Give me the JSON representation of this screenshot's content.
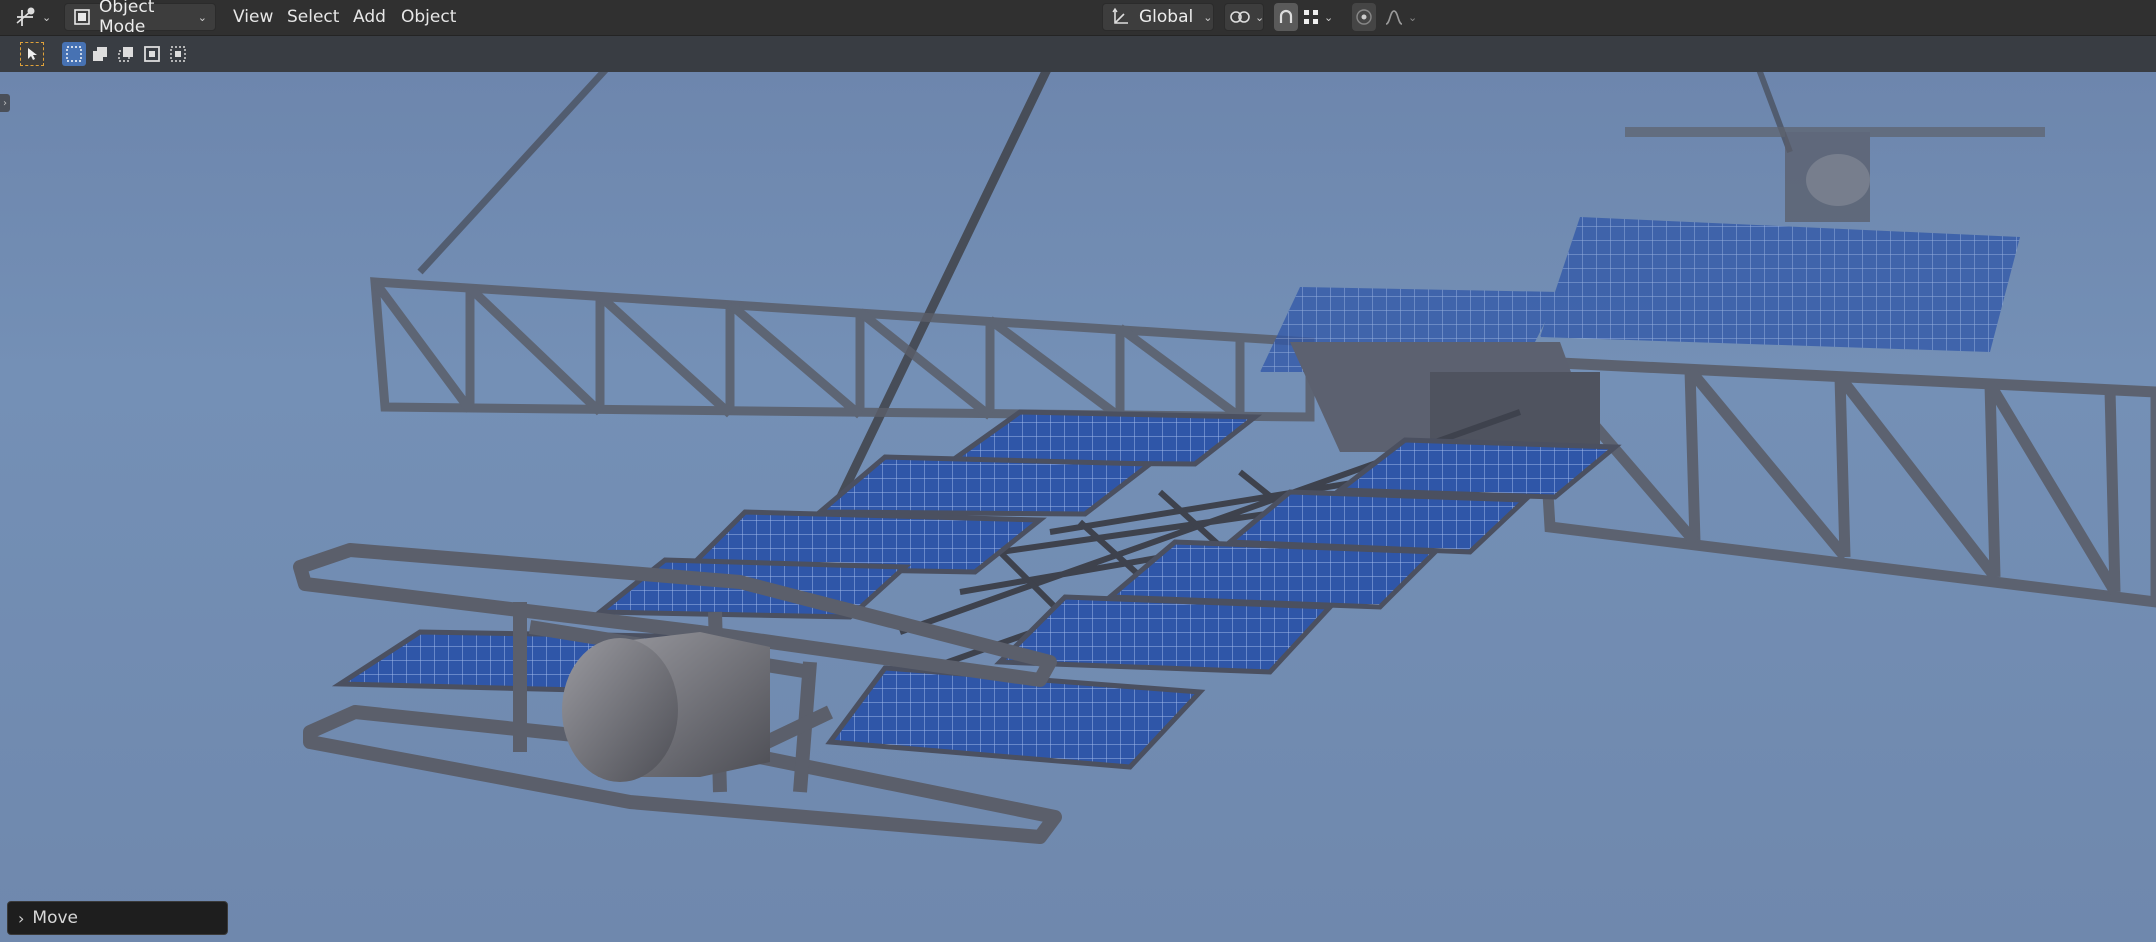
{
  "header": {
    "mode_label": "Object Mode",
    "menus": [
      "View",
      "Select",
      "Add",
      "Object"
    ],
    "orientation_label": "Global"
  },
  "icons": {
    "editor_type": "view3d-gizmo-icon",
    "mode": "object-mode-icon",
    "orientation": "transform-orientation-icon",
    "pivot": "pivot-point-icon",
    "snap": "snap-magnet-icon",
    "snap_target": "snap-increment-icon",
    "proportional": "proportional-editing-icon",
    "falloff": "falloff-curve-icon",
    "tool": "select-box-tool-icon",
    "select_modes": [
      "select-new-icon",
      "select-extend-icon",
      "select-subtract-icon",
      "select-invert-icon",
      "select-intersect-icon"
    ]
  },
  "viewport": {
    "subject": "satellite-render",
    "background_color": "#7189b0"
  },
  "operator_panel": {
    "label": "Move"
  }
}
